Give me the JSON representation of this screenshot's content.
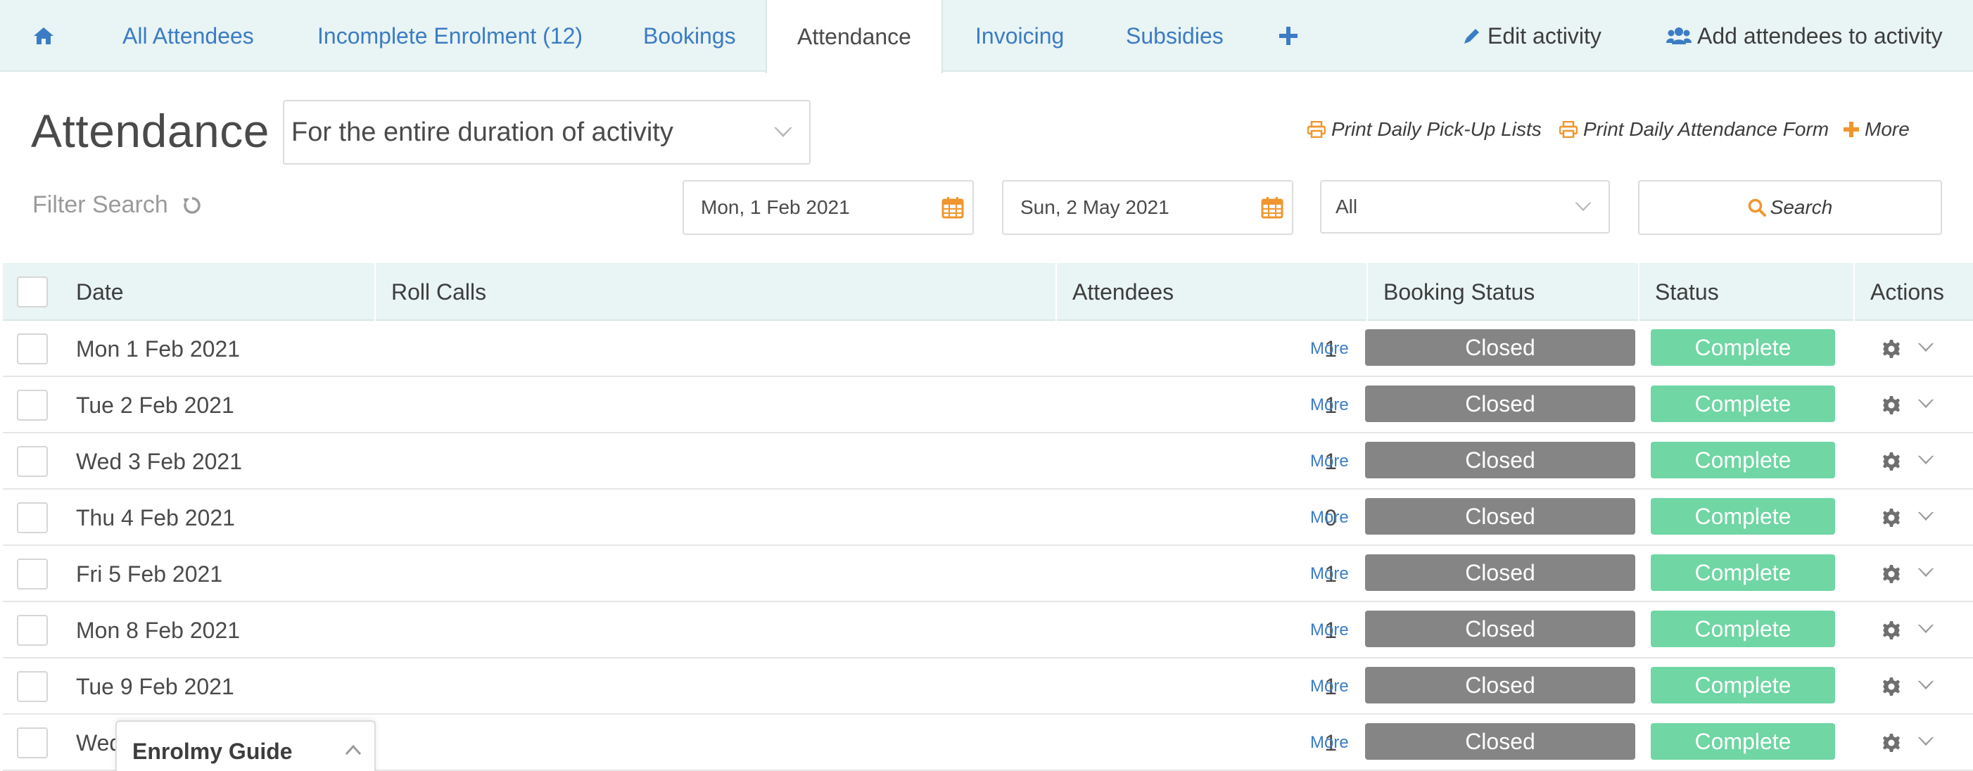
{
  "tabs": [
    {
      "id": "home",
      "label": "",
      "icon": "home-icon"
    },
    {
      "id": "all-attendees",
      "label": "All Attendees"
    },
    {
      "id": "incomplete-enrolment",
      "label": "Incomplete Enrolment (12)"
    },
    {
      "id": "bookings",
      "label": "Bookings"
    },
    {
      "id": "attendance",
      "label": "Attendance",
      "active": true
    },
    {
      "id": "invoicing",
      "label": "Invoicing"
    },
    {
      "id": "subsidies",
      "label": "Subsidies"
    },
    {
      "id": "add-tab",
      "label": "",
      "icon": "plus-icon"
    }
  ],
  "tab_actions": {
    "edit_activity": "Edit activity",
    "add_attendees": "Add attendees to activity"
  },
  "page": {
    "title": "Attendance",
    "scope_select": "For the entire duration of activity",
    "print_pickup": "Print Daily Pick-Up Lists",
    "print_attendance": "Print Daily Attendance Form",
    "more": "More"
  },
  "filters": {
    "label": "Filter Search",
    "start_date": "Mon, 1 Feb 2021",
    "end_date": "Sun, 2 May 2021",
    "status": "All",
    "search_label": "Search"
  },
  "table": {
    "columns": {
      "date": "Date",
      "roll_calls": "Roll Calls",
      "attendees": "Attendees",
      "booking_status": "Booking Status",
      "status": "Status",
      "actions": "Actions"
    },
    "more_label": "More",
    "rows": [
      {
        "date": "Mon 1 Feb 2021",
        "attendees": "1",
        "booking_status": "Closed",
        "status": "Complete"
      },
      {
        "date": "Tue 2 Feb 2021",
        "attendees": "1",
        "booking_status": "Closed",
        "status": "Complete"
      },
      {
        "date": "Wed 3 Feb 2021",
        "attendees": "1",
        "booking_status": "Closed",
        "status": "Complete"
      },
      {
        "date": "Thu 4 Feb 2021",
        "attendees": "0",
        "booking_status": "Closed",
        "status": "Complete"
      },
      {
        "date": "Fri 5 Feb 2021",
        "attendees": "1",
        "booking_status": "Closed",
        "status": "Complete"
      },
      {
        "date": "Mon 8 Feb 2021",
        "attendees": "1",
        "booking_status": "Closed",
        "status": "Complete"
      },
      {
        "date": "Tue 9 Feb 2021",
        "attendees": "1",
        "booking_status": "Closed",
        "status": "Complete"
      },
      {
        "date": "Wed",
        "attendees": "1",
        "booking_status": "Closed",
        "status": "Complete"
      }
    ]
  },
  "guide": {
    "title": "Enrolmy Guide"
  },
  "colors": {
    "link": "#3b7cc4",
    "accent_orange": "#f0962e",
    "closed": "#858585",
    "complete": "#6fd6a4",
    "tab_bg": "#e9f4f4"
  }
}
